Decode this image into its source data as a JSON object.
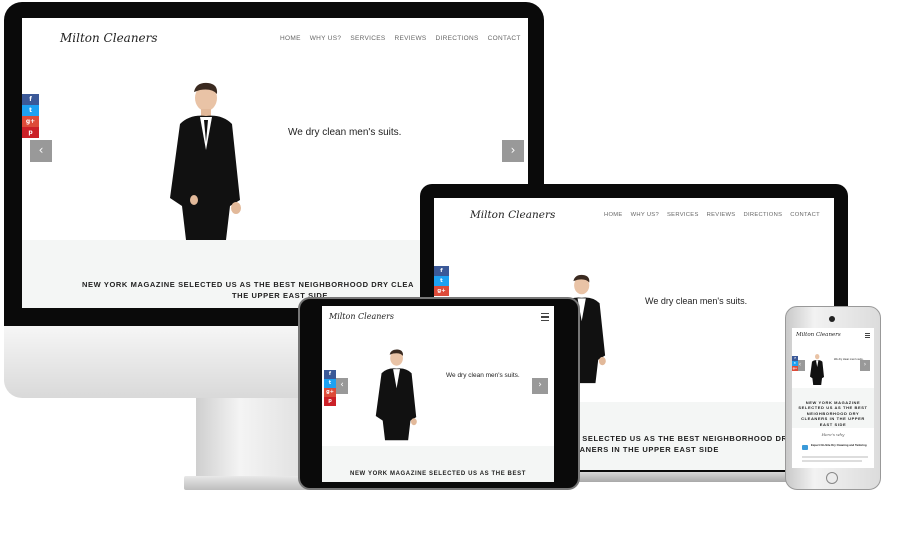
{
  "site": {
    "logo": "Milton Cleaners",
    "nav": [
      "HOME",
      "WHY US?",
      "SERVICES",
      "REVIEWS",
      "DIRECTIONS",
      "CONTACT"
    ],
    "tagline": "We dry clean men's suits.",
    "arrows": {
      "prev": "‹",
      "next": "›"
    },
    "social": [
      {
        "name": "facebook",
        "glyph": "f"
      },
      {
        "name": "twitter",
        "glyph": "t"
      },
      {
        "name": "google-plus",
        "glyph": "g+"
      },
      {
        "name": "pinterest",
        "glyph": "p"
      }
    ],
    "colors": {
      "facebook": "#3b5998",
      "twitter": "#1da1f2",
      "google_plus": "#dd4b39",
      "pinterest": "#cb2027",
      "arrow": "#999999",
      "band": "#f4f6f5"
    }
  },
  "desktop": {
    "band_line1": "NEW YORK MAGAZINE SELECTED US AS THE BEST NEIGHBORHOOD DRY CLEA",
    "band_line2": "THE UPPER EAST SIDE"
  },
  "laptop": {
    "band_line1": "E SELECTED US AS THE BEST NEIGHBORHOOD DRY",
    "band_line2": "EANERS IN THE UPPER EAST SIDE"
  },
  "tablet": {
    "band_line1": "NEW YORK MAGAZINE SELECTED US AS THE BEST"
  },
  "phone": {
    "band_text": "NEW YORK MAGAZINE SELECTED US AS THE BEST NEIGHBORHOOD DRY CLEANERS IN THE UPPER EAST SIDE",
    "section_heading": "Here's why",
    "feature_title": "Expert On-Site Dry Cleaning and Tailoring"
  }
}
